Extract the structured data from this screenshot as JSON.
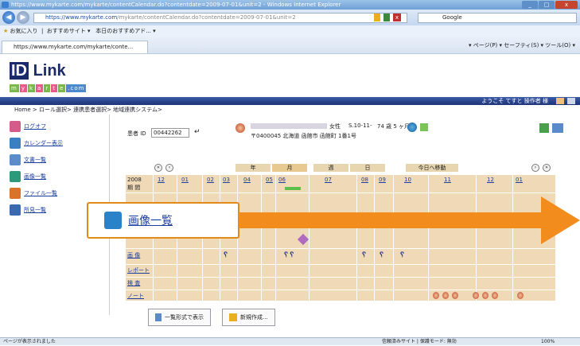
{
  "window": {
    "title": "https://www.mykarte.com/mykarte/contentCalendar.do?contentdate=2009-07-01&unit=2 - Windows Internet Explorer",
    "url_main": "https://www.mykarte.com",
    "url_rest": "/mykarte/contentCalendar.do?contentdate=2009-07-01&unit=2",
    "search_engine": "Google",
    "favorites": "お気に入り",
    "suggested_sites": "おすすめサイト ▾",
    "todays_pick": "本日のおすすめアド... ▾",
    "tab_label": "https://www.mykarte.com/mykarte/conte...",
    "ie_tools": "▾ ページ(P) ▾  セーフティ(S) ▾  ツール(O) ▾"
  },
  "header": {
    "logo_id": "ID",
    "logo_text": "Link",
    "sub_logo": [
      "m",
      "y",
      "k",
      "a",
      "r",
      "t",
      "e",
      ".com"
    ],
    "welcome": "ようこそ てすと 操作者 様"
  },
  "breadcrumb": "Home > ロール選択> 連携患者選択> 地域連携システム>",
  "sidebar": {
    "items": [
      {
        "label": "ログオフ",
        "icon": "logout-icon",
        "color": "#d45b8a"
      },
      {
        "label": "カレンダー表示",
        "icon": "calendar-icon",
        "color": "#3a7fc1"
      },
      {
        "label": "文書一覧",
        "icon": "document-list-icon",
        "color": "#5a8cc9"
      },
      {
        "label": "画像一覧",
        "icon": "image-list-icon",
        "color": "#2a9a7a"
      },
      {
        "label": "ファイル一覧",
        "icon": "file-list-icon",
        "color": "#d9732a"
      },
      {
        "label": "所見一覧",
        "icon": "findings-list-icon",
        "color": "#3a6ab0"
      }
    ]
  },
  "patient": {
    "id_label": "患者 ID",
    "id_value": "00442262",
    "sex": "女性",
    "dob": "S.10-11-",
    "age": "74 歳 5 ヶ月",
    "address": "〒0400045 北海道 函館市 函館町 1番1号"
  },
  "calendar": {
    "unit_buttons": [
      "年",
      "月",
      "週",
      "日"
    ],
    "goto_today": "今日へ移動",
    "year": "2008",
    "period_label": "期 間",
    "months": [
      "12",
      "01",
      "02",
      "03",
      "04",
      "05",
      "06",
      "07",
      "08",
      "09",
      "10",
      "11",
      "12",
      "01"
    ],
    "row_labels": [
      "画 像",
      "レポート",
      "検 査",
      "ノート"
    ]
  },
  "callout": {
    "label": "画像一覧"
  },
  "bottom_buttons": [
    {
      "label": "一覧形式で表示"
    },
    {
      "label": "新規作成..."
    }
  ],
  "status": {
    "left": "ページが表示されました",
    "right": "信頼済みサイト | 保護モード: 無効",
    "zoom": "100%"
  },
  "colors": {
    "accent": "#1a2a6a",
    "grid": "#efd9b6",
    "callout_border": "#e08a1a",
    "link": "#1a3ea0"
  }
}
